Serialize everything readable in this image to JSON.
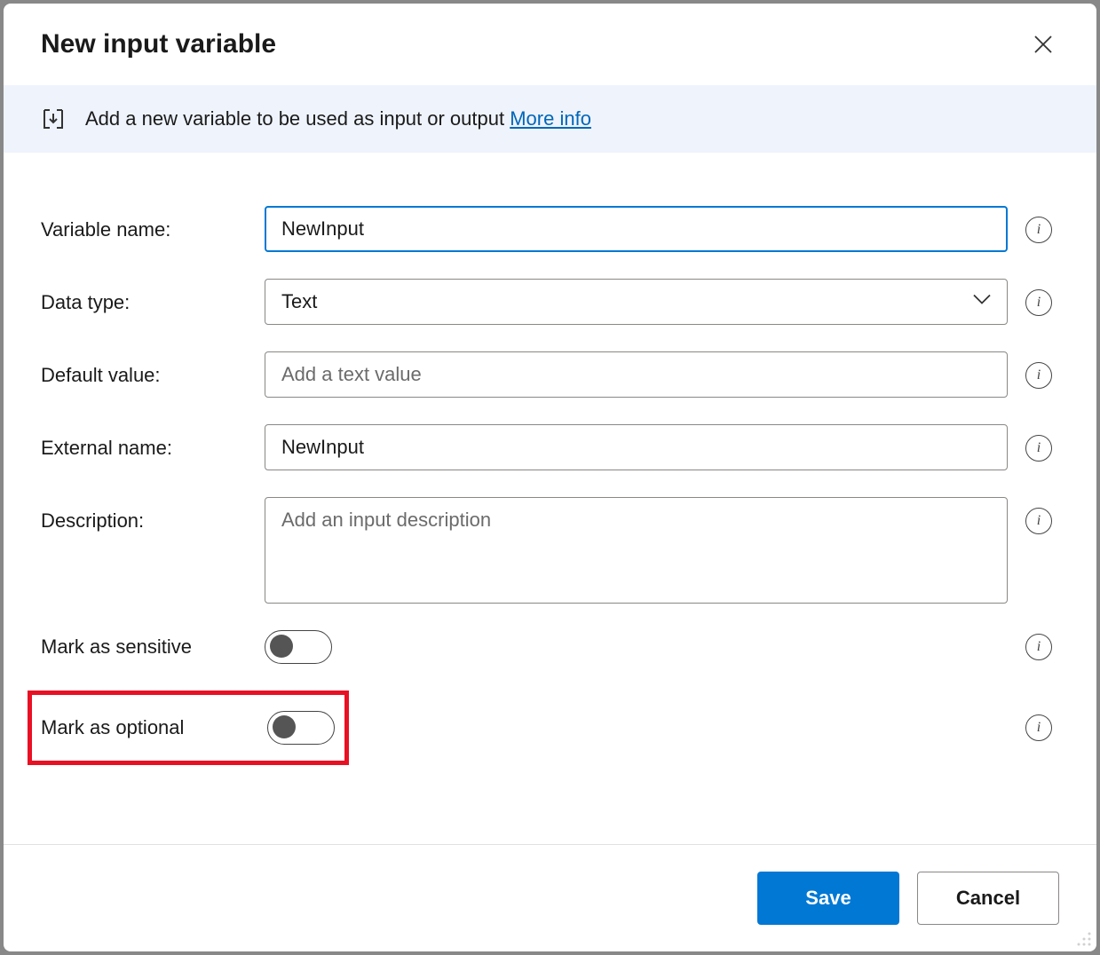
{
  "dialog": {
    "title": "New input variable"
  },
  "banner": {
    "text": "Add a new variable to be used as input or output ",
    "link": "More info"
  },
  "form": {
    "variable_name": {
      "label": "Variable name:",
      "value": "NewInput"
    },
    "data_type": {
      "label": "Data type:",
      "value": "Text"
    },
    "default_value": {
      "label": "Default value:",
      "placeholder": "Add a text value",
      "value": ""
    },
    "external_name": {
      "label": "External name:",
      "value": "NewInput"
    },
    "description": {
      "label": "Description:",
      "placeholder": "Add an input description",
      "value": ""
    },
    "sensitive": {
      "label": "Mark as sensitive",
      "on": false
    },
    "optional": {
      "label": "Mark as optional",
      "on": false
    }
  },
  "footer": {
    "save": "Save",
    "cancel": "Cancel"
  }
}
